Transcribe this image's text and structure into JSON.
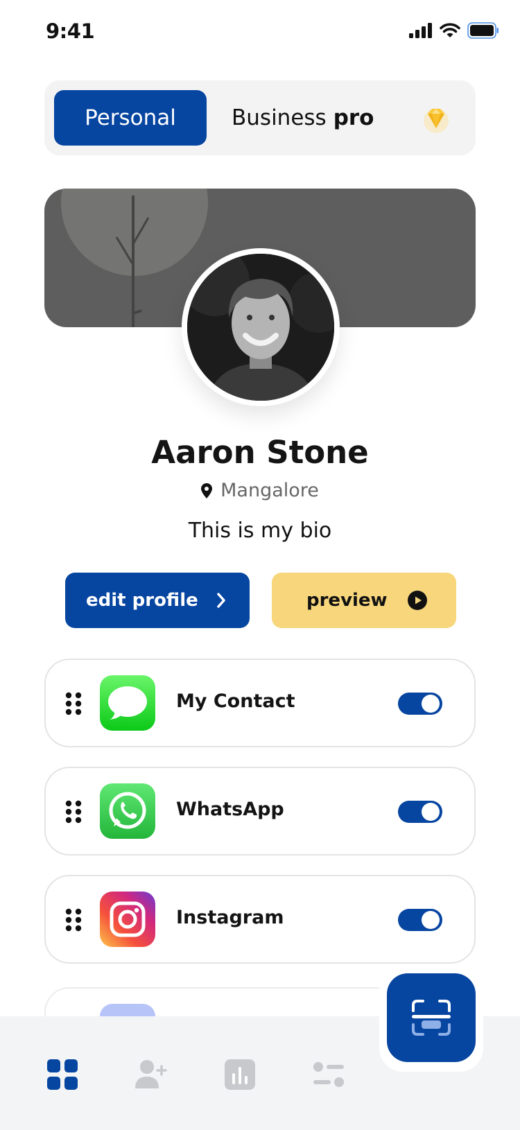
{
  "status_bar": {
    "time": "9:41"
  },
  "mode_switch": {
    "personal_label": "Personal",
    "business_label": "Business",
    "business_suffix": "pro"
  },
  "profile": {
    "name": "Aaron Stone",
    "location": "Mangalore",
    "bio": "This is my bio"
  },
  "actions": {
    "edit_label": "edit profile",
    "preview_label": "preview"
  },
  "links": [
    {
      "label": "My Contact",
      "icon": "messages-icon",
      "enabled": true
    },
    {
      "label": "WhatsApp",
      "icon": "whatsapp-icon",
      "enabled": true
    },
    {
      "label": "Instagram",
      "icon": "instagram-icon",
      "enabled": true
    }
  ],
  "bottom_nav": {
    "items": [
      "dashboard-icon",
      "add-user-icon",
      "analytics-icon",
      "settings-sliders-icon"
    ],
    "active": "dashboard-icon"
  },
  "colors": {
    "primary": "#0645a0",
    "accent_yellow": "#f7d67c",
    "cover_gray": "#5e5e5e",
    "nav_bg": "#f3f4f6",
    "inactive_icon": "#c7c9cd"
  }
}
